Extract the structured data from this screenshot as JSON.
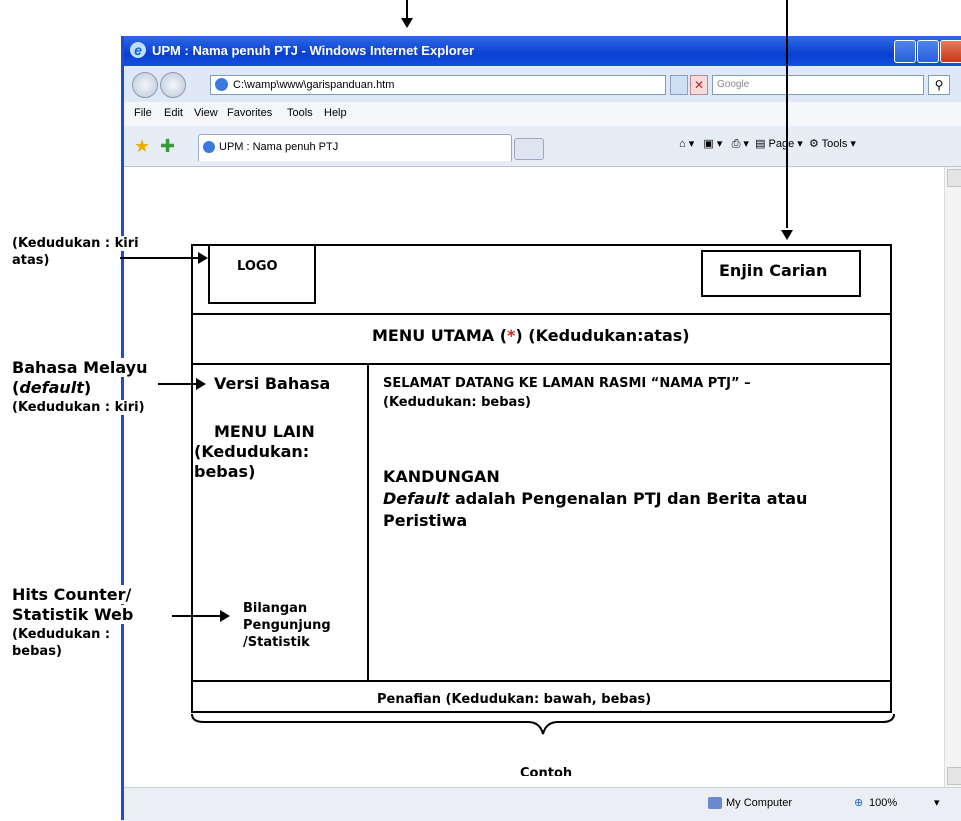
{
  "browser": {
    "window_title": "UPM : Nama penuh PTJ - Windows Internet Explorer",
    "address": "C:\\wamp\\www\\garispanduan.htm",
    "search_placeholder": "Google",
    "menu": [
      "File",
      "Edit",
      "View",
      "Favorites",
      "Tools",
      "Help"
    ],
    "tab_title": "UPM : Nama penuh PTJ",
    "commands": [
      "Page",
      "Tools"
    ],
    "status_zone": "My Computer",
    "zoom": "100%"
  },
  "annotations": {
    "logo_position": [
      "(Kedudukan : kiri",
      "atas)"
    ],
    "language_default": [
      "Bahasa Melayu",
      "default",
      "(Kedudukan : kiri)"
    ],
    "hits_counter": [
      "Hits Counter/",
      "Statistik Web",
      "(Kedudukan :",
      "bebas)"
    ]
  },
  "layout": {
    "logo": "LOGO",
    "search_engine": "Enjin Carian",
    "main_menu_prefix": "MENU UTAMA (",
    "main_menu_star": "*",
    "main_menu_suffix": ") (Kedudukan:atas)",
    "language_version": "Versi Bahasa",
    "other_menu": [
      "MENU LAIN",
      "(Kedudukan:",
      "bebas)"
    ],
    "visitor_count": [
      "Bilangan",
      "Pengunjung",
      "/Statistik"
    ],
    "welcome": [
      "SELAMAT DATANG KE LAMAN RASMI “NAMA PTJ” –",
      "(Kedudukan: bebas)"
    ],
    "content_heading": "KANDUNGAN",
    "content_default": "Default",
    "content_rest": [
      " adalah Pengenalan PTJ dan Berita atau",
      "Peristiwa"
    ],
    "disclaimer": "Penafian (Kedudukan: bawah, bebas)",
    "truncated_caption": "Contoh"
  }
}
